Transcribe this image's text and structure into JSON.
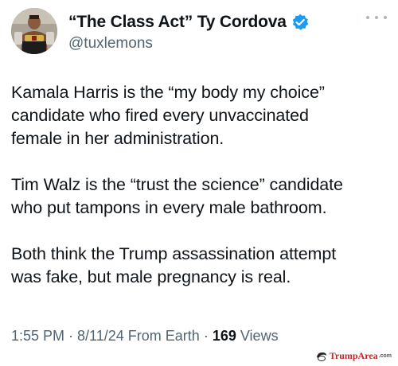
{
  "tweet": {
    "author": {
      "display_name": "“The Class Act” Ty Cordova",
      "handle": "@tuxlemons",
      "verified": true,
      "avatar_icon": "profile-photo"
    },
    "paragraphs": [
      "Kamala Harris is the “my body my choice”\ncandidate who fired every unvaccinated\nfemale in her administration.",
      "Tim Walz is the “trust the science” candidate\nwho put tampons in every male bathroom.",
      "Both think the Trump assassination attempt\nwas fake, but male pregnancy is real."
    ],
    "meta": {
      "time": "1:55 PM",
      "separator": " · ",
      "date": "8/11/24",
      "source": "From Earth",
      "views_count": "169",
      "views_label": " Views"
    }
  },
  "watermark": {
    "brand": "TrumpArea",
    "tld": ".com"
  },
  "colors": {
    "text": "#0f1419",
    "secondary": "#536471",
    "verified_badge": "#1d9bf0",
    "watermark_red": "#c0282d"
  }
}
